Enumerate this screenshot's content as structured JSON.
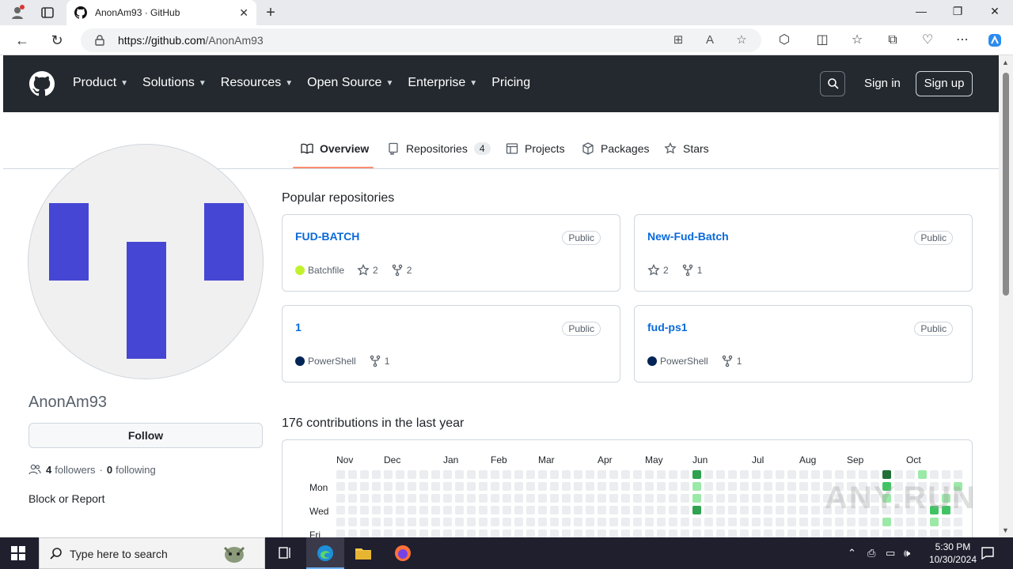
{
  "browser": {
    "tab_title": "AnonAm93 · GitHub",
    "url_domain": "https://github.com",
    "url_path": "/AnonAm93"
  },
  "header": {
    "nav": [
      {
        "label": "Product",
        "has_menu": true
      },
      {
        "label": "Solutions",
        "has_menu": true
      },
      {
        "label": "Resources",
        "has_menu": true
      },
      {
        "label": "Open Source",
        "has_menu": true
      },
      {
        "label": "Enterprise",
        "has_menu": true
      },
      {
        "label": "Pricing",
        "has_menu": false
      }
    ],
    "sign_in": "Sign in",
    "sign_up": "Sign up"
  },
  "tabs": {
    "overview": "Overview",
    "repositories": "Repositories",
    "repositories_count": "4",
    "projects": "Projects",
    "packages": "Packages",
    "stars": "Stars"
  },
  "profile": {
    "username": "AnonAm93",
    "follow": "Follow",
    "followers_count": "4",
    "followers_label": "followers",
    "separator": "·",
    "following_count": "0",
    "following_label": "following",
    "block_report": "Block or Report"
  },
  "popular": {
    "title": "Popular repositories",
    "repos": [
      {
        "name": "FUD-BATCH",
        "visibility": "Public",
        "language": "Batchfile",
        "lang_color": "#C1F12E",
        "stars": "2",
        "forks": "2"
      },
      {
        "name": "New-Fud-Batch",
        "visibility": "Public",
        "language": "",
        "lang_color": "",
        "stars": "2",
        "forks": "1"
      },
      {
        "name": "1",
        "visibility": "Public",
        "language": "PowerShell",
        "lang_color": "#012456",
        "stars": "",
        "forks": "1"
      },
      {
        "name": "fud-ps1",
        "visibility": "Public",
        "language": "PowerShell",
        "lang_color": "#012456",
        "stars": "",
        "forks": "1"
      }
    ]
  },
  "contributions": {
    "title": "176 contributions in the last year",
    "months": [
      "Nov",
      "Dec",
      "Jan",
      "Feb",
      "Mar",
      "Apr",
      "May",
      "Jun",
      "Jul",
      "Aug",
      "Sep",
      "Oct"
    ],
    "days": [
      "Mon",
      "Wed",
      "Fri"
    ]
  },
  "watermark": "ANY.RUN",
  "taskbar": {
    "search_placeholder": "Type here to search",
    "time": "5:30 PM",
    "date": "10/30/2024"
  }
}
